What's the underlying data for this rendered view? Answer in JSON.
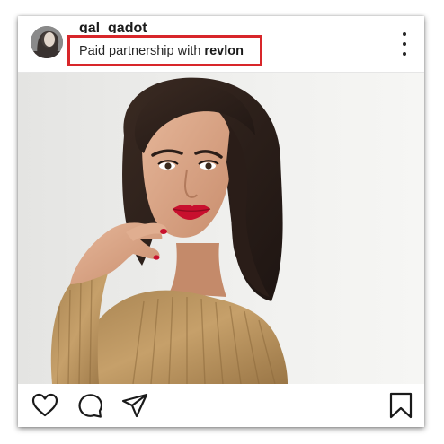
{
  "post": {
    "username": "gal_gadot",
    "sponsor_prefix": "Paid partnership with",
    "sponsor_name": "revlon"
  },
  "icons": {
    "more": "more-options-icon",
    "like": "heart-icon",
    "comment": "comment-icon",
    "share": "paper-plane-icon",
    "save": "bookmark-icon"
  },
  "colors": {
    "highlight": "#d8262a",
    "lipstick": "#c8102e",
    "sweater": "#b8935a"
  }
}
